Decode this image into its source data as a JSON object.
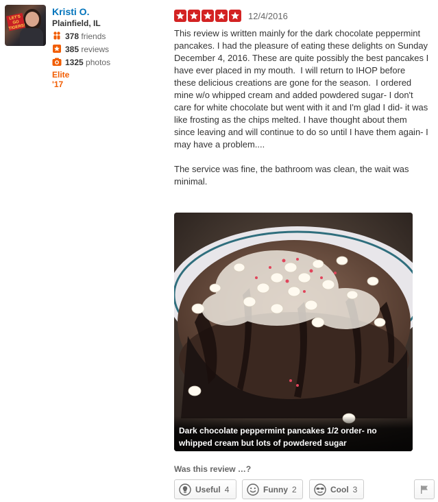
{
  "user": {
    "name": "Kristi O.",
    "location": "Plainfield, IL",
    "friends_count": "378",
    "friends_label": "friends",
    "reviews_count": "385",
    "reviews_label": "reviews",
    "photos_count": "1325",
    "photos_label": "photos",
    "elite": "Elite '17",
    "avatar_sign_text": "LET'S GO TIGERS!"
  },
  "review": {
    "rating": 5,
    "date": "12/4/2016",
    "text": "This review is written mainly for the dark chocolate peppermint pancakes. I had the pleasure of eating these delights on Sunday December 4, 2016. These are quite possibly the best pancakes I have ever placed in my mouth.  I will return to IHOP before these delicious creations are gone for the season.  I ordered mine w/o whipped cream and added powdered sugar- I don't care for white chocolate but went with it and I'm glad I did- it was like frosting as the chips melted. I have thought about them since leaving and will continue to do so until I have them again- I may have a problem....\n\nThe service was fine, the bathroom was clean, the wait was minimal."
  },
  "photo": {
    "caption": "Dark chocolate peppermint pancakes 1/2 order- no whipped cream but lots of powdered sugar"
  },
  "feedback": {
    "prompt": "Was this review …?",
    "useful": {
      "label": "Useful",
      "count": "4"
    },
    "funny": {
      "label": "Funny",
      "count": "2"
    },
    "cool": {
      "label": "Cool",
      "count": "3"
    }
  },
  "colors": {
    "link": "#0073bb",
    "star": "#d32323",
    "elite": "#f15c00",
    "icon_orange": "#f15c00"
  },
  "icons": [
    "friends-icon",
    "review-star-icon",
    "camera-icon",
    "star-icon",
    "lightbulb-icon",
    "smile-icon",
    "sunglasses-icon",
    "flag-icon"
  ]
}
